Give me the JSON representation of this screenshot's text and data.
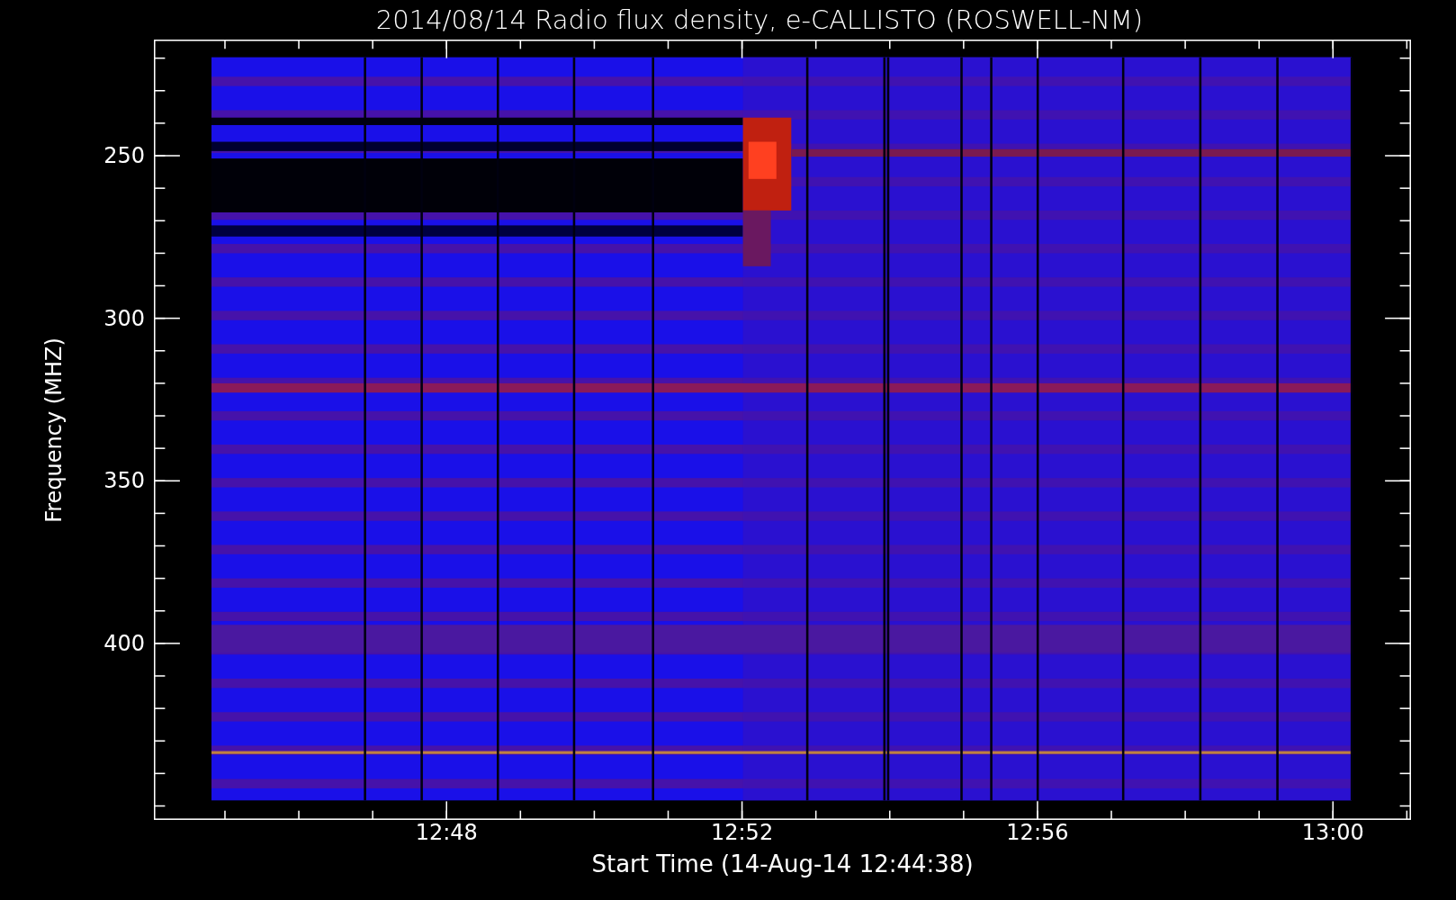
{
  "title": "2014/08/14  Radio flux density, e-CALLISTO (ROSWELL-NM)",
  "y_axis": {
    "label": "Frequency (MHZ)",
    "ticks": [
      "250",
      "300",
      "350",
      "400"
    ]
  },
  "x_axis": {
    "label": "Start Time (14-Aug-14 12:44:38)",
    "ticks": [
      "12:48",
      "12:52",
      "12:56",
      "13:00"
    ]
  }
}
